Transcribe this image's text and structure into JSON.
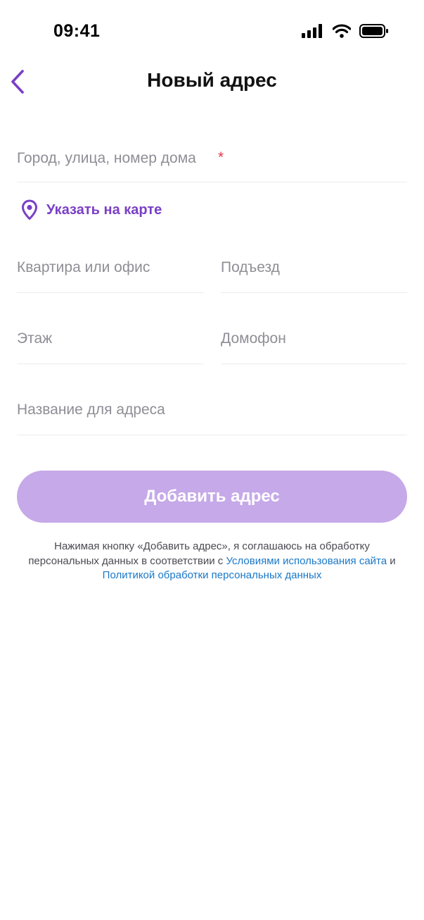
{
  "status_bar": {
    "time": "09:41",
    "icons": [
      "signal-icon",
      "wifi-icon",
      "battery-icon"
    ]
  },
  "header": {
    "title": "Новый адрес",
    "back_icon": "chevron-left-icon"
  },
  "form": {
    "address_placeholder": "Город, улица, номер дома",
    "address_required_mark": "*",
    "map_link_label": "Указать на карте",
    "map_link_icon": "map-pin-icon",
    "apartment_placeholder": "Квартира или офис",
    "entrance_placeholder": "Подъезд",
    "floor_placeholder": "Этаж",
    "intercom_placeholder": "Домофон",
    "address_name_placeholder": "Название для адреса",
    "submit_label": "Добавить адрес"
  },
  "consent": {
    "text_before": "Нажимая кнопку «Добавить адрес», я соглашаюсь на обработку персональных данных в соответствии с",
    "terms_link": "Условиями использования сайта",
    "conjunction": "и",
    "privacy_link": "Политикой обработки персональных данных"
  },
  "colors": {
    "accent": "#7a3fc6",
    "button_disabled": "#c6a9e8",
    "link": "#1a78c8",
    "required": "#e0394d"
  }
}
